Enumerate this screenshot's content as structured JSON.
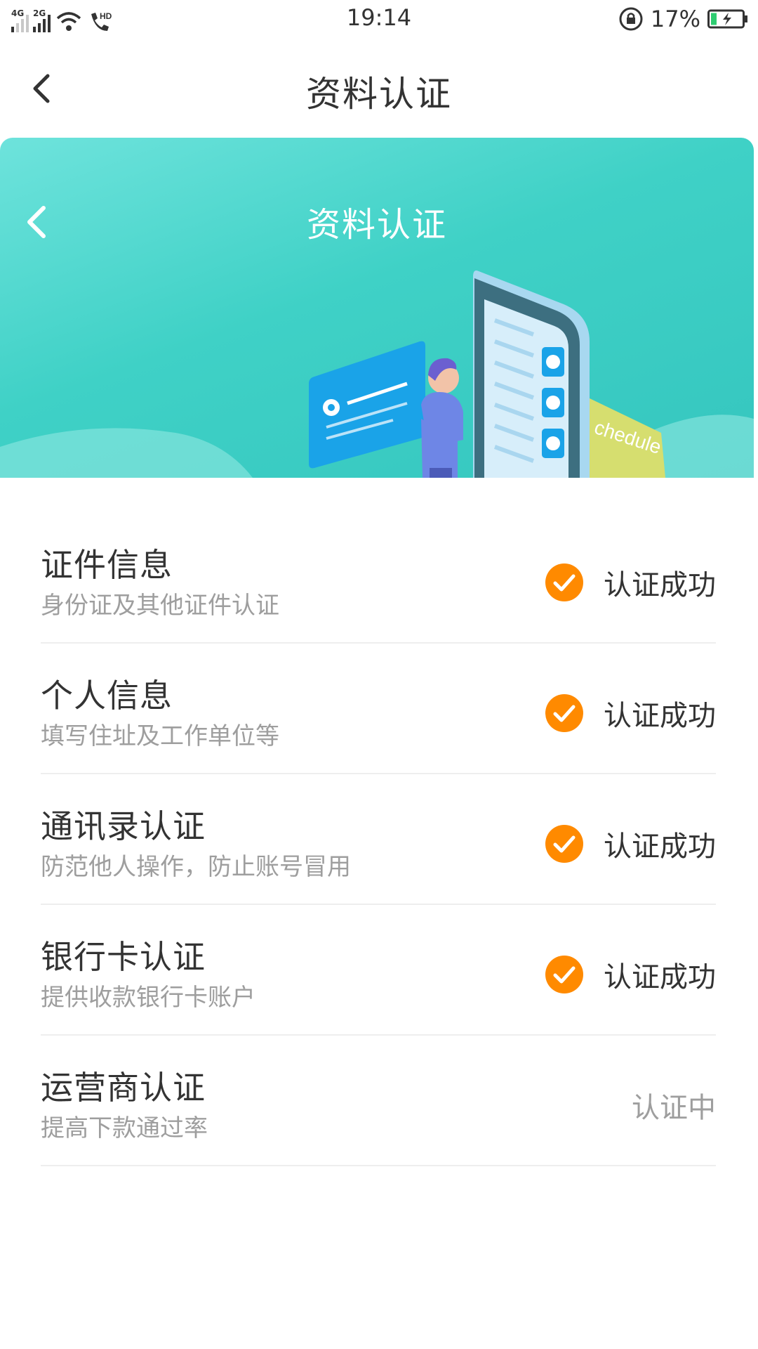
{
  "status_bar": {
    "time": "19:14",
    "battery": "17%",
    "network_1": "4G",
    "network_2": "2G",
    "call_label": "HD"
  },
  "nav": {
    "title": "资料认证"
  },
  "banner": {
    "title": "资料认证",
    "card_text": "chedule"
  },
  "items": [
    {
      "title": "证件信息",
      "subtitle": "身份证及其他证件认证",
      "status": "认证成功",
      "verified": true
    },
    {
      "title": "个人信息",
      "subtitle": "填写住址及工作单位等",
      "status": "认证成功",
      "verified": true
    },
    {
      "title": "通讯录认证",
      "subtitle": "防范他人操作，防止账号冒用",
      "status": "认证成功",
      "verified": true
    },
    {
      "title": "银行卡认证",
      "subtitle": "提供收款银行卡账户",
      "status": "认证成功",
      "verified": true
    },
    {
      "title": "运营商认证",
      "subtitle": "提高下款通过率",
      "status": "认证中",
      "verified": false
    }
  ],
  "colors": {
    "accent": "#ff8a00",
    "banner": "#3fd1c6"
  }
}
